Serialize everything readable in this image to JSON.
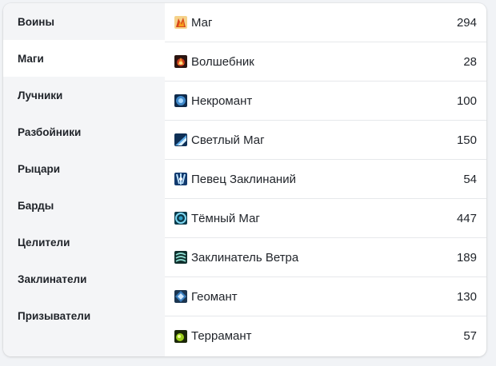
{
  "sidebar": {
    "items": [
      {
        "label": "Воины"
      },
      {
        "label": "Маги"
      },
      {
        "label": "Лучники"
      },
      {
        "label": "Разбойники"
      },
      {
        "label": "Рыцари"
      },
      {
        "label": "Барды"
      },
      {
        "label": "Целители"
      },
      {
        "label": "Заклинатели"
      },
      {
        "label": "Призыватели"
      }
    ],
    "active_index": 1
  },
  "classes": [
    {
      "name": "Маг",
      "count": "294",
      "icon": "fire-mage-icon",
      "color": "#e0662a"
    },
    {
      "name": "Волшебник",
      "count": "28",
      "icon": "sorcerer-icon",
      "color": "#c2361e"
    },
    {
      "name": "Некромант",
      "count": "100",
      "icon": "necromancer-icon",
      "color": "#3f88c9"
    },
    {
      "name": "Светлый Маг",
      "count": "150",
      "icon": "light-mage-icon",
      "color": "#5aa9e6"
    },
    {
      "name": "Певец Заклинаний",
      "count": "54",
      "icon": "spellsinger-icon",
      "color": "#4a8fd8"
    },
    {
      "name": "Тёмный Маг",
      "count": "447",
      "icon": "dark-mage-icon",
      "color": "#2fa0c8"
    },
    {
      "name": "Заклинатель Ветра",
      "count": "189",
      "icon": "wind-caster-icon",
      "color": "#2f8a86"
    },
    {
      "name": "Геомант",
      "count": "130",
      "icon": "geomancer-icon",
      "color": "#3a7fbf"
    },
    {
      "name": "Террамант",
      "count": "57",
      "icon": "terramancer-icon",
      "color": "#9acd1a"
    }
  ]
}
